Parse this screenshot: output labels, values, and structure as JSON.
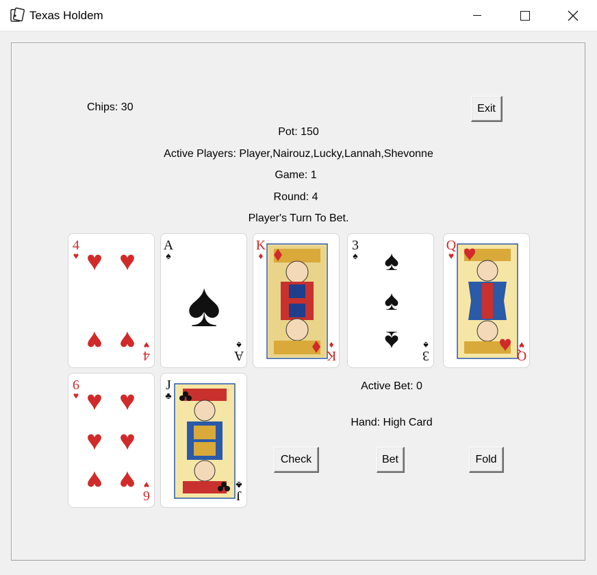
{
  "window": {
    "title": "Texas Holdem",
    "controls": [
      "minimize",
      "maximize",
      "close"
    ]
  },
  "status": {
    "chips": "Chips: 30",
    "pot": "Pot: 150",
    "active_players": "Active Players: Player,Nairouz,Lucky,Lannah,Shevonne",
    "game": "Game: 1",
    "round": "Round: 4",
    "turn": "Player's Turn To Bet.",
    "active_bet": "Active Bet: 0",
    "hand": "Hand: High Card"
  },
  "buttons": {
    "exit": "Exit",
    "check": "Check",
    "bet": "Bet",
    "fold": "Fold"
  },
  "community_cards": [
    {
      "rank": "4",
      "suit": "♥",
      "color": "#d12a2a"
    },
    {
      "rank": "A",
      "suit": "♠",
      "color": "#111111"
    },
    {
      "rank": "K",
      "suit": "♦",
      "color": "#d12a2a"
    },
    {
      "rank": "3",
      "suit": "♠",
      "color": "#111111"
    },
    {
      "rank": "Q",
      "suit": "♥",
      "color": "#d12a2a"
    }
  ],
  "hole_cards": [
    {
      "rank": "6",
      "suit": "♥",
      "color": "#d12a2a"
    },
    {
      "rank": "J",
      "suit": "♣",
      "color": "#111111"
    }
  ]
}
